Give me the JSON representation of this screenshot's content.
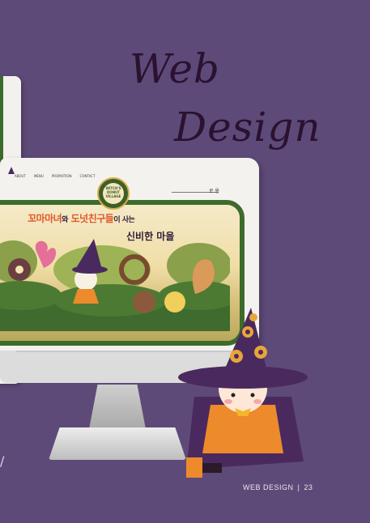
{
  "title": {
    "line1": "Web",
    "line2": "Design"
  },
  "site": {
    "nav": [
      "ABOUT",
      "MENU",
      "PROMOTION",
      "CONTACT"
    ],
    "login": "로 용",
    "badge": "WITCH'S DONUT VILLAGE",
    "headline_orange_a": "꼬마마녀",
    "headline_dark_a": "와",
    "headline_orange_b": "도넛친구들",
    "headline_dark_b": "이 사는",
    "headline_line2": "신비한 마을"
  },
  "footer": {
    "label": "WEB DESIGN",
    "separator": "|",
    "page": "23"
  },
  "colors": {
    "background": "#5e4a78",
    "title": "#2a1230",
    "banner_border": "#3d6b2c",
    "accent": "#e0582a",
    "hat": "#4a2a5e"
  }
}
